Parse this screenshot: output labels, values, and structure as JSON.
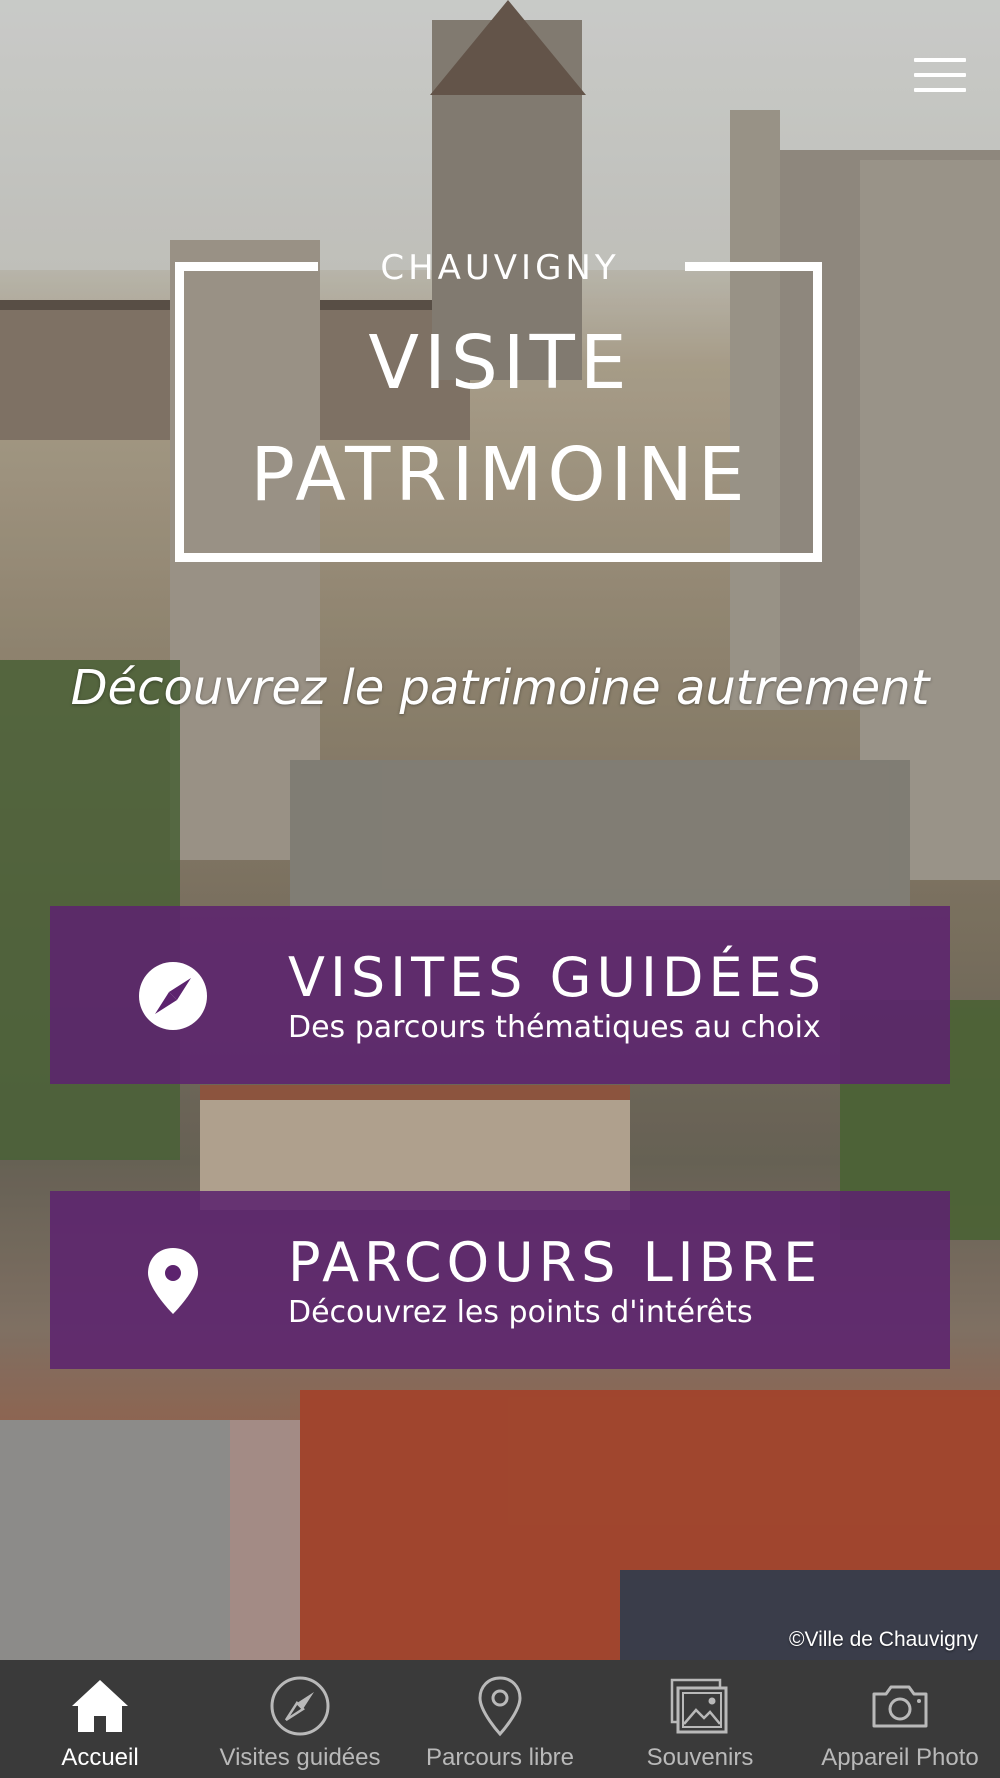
{
  "header": {
    "city": "CHAUVIGNY",
    "title_line1": "VISITE",
    "title_line2": "PATRIMOINE",
    "tagline": "Découvrez le patrimoine autrement"
  },
  "cards": [
    {
      "title": "VISITES GUIDÉES",
      "subtitle": "Des parcours thématiques au choix",
      "icon": "compass-icon"
    },
    {
      "title": "PARCOURS LIBRE",
      "subtitle": "Découvrez les points d'intérêts",
      "icon": "location-pin-icon"
    }
  ],
  "credit": "©Ville de Chauvigny",
  "tabbar": {
    "active": "Accueil",
    "items": [
      {
        "label": "Accueil",
        "icon": "home-icon"
      },
      {
        "label": "Visites guidées",
        "icon": "compass-icon"
      },
      {
        "label": "Parcours libre",
        "icon": "location-pin-icon"
      },
      {
        "label": "Souvenirs",
        "icon": "photos-icon"
      },
      {
        "label": "Appareil Photo",
        "icon": "camera-icon"
      }
    ]
  },
  "colors": {
    "card_purple": "#5c236e",
    "tabbar_bg": "#3a3a3a",
    "tab_inactive": "#b9b9b9",
    "tab_active": "#ffffff"
  }
}
